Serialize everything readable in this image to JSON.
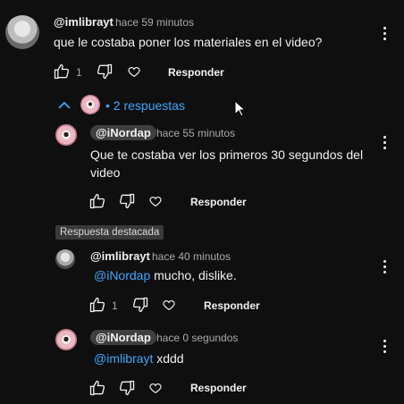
{
  "comment": {
    "author": "@imlibrayt",
    "time": "hace 59 minutos",
    "text": "que le costaba poner los materiales en el video?",
    "likes": "1",
    "reply_label": "Responder",
    "replies_toggle": "2 respuestas"
  },
  "replies": [
    {
      "author": "@iNordap",
      "time": "hace 55 minutos",
      "text_line1": "Que te costaba ver los primeros 30 segundos del",
      "text_line2": "video",
      "reply_label": "Responder"
    },
    {
      "badge": "Respuesta destacada",
      "author": "@imlibrayt",
      "time": "hace 40 minutos",
      "mention": "@iNordap",
      "text": "mucho, dislike.",
      "likes": "1",
      "reply_label": "Responder"
    },
    {
      "author": "@iNordap",
      "time": "hace 0 segundos",
      "mention": "@imlibrayt",
      "text": "xddd",
      "reply_label": "Responder"
    }
  ],
  "colors": {
    "background": "#0f0f0f",
    "link": "#3ea6ff",
    "muted": "#aaaaaa"
  }
}
